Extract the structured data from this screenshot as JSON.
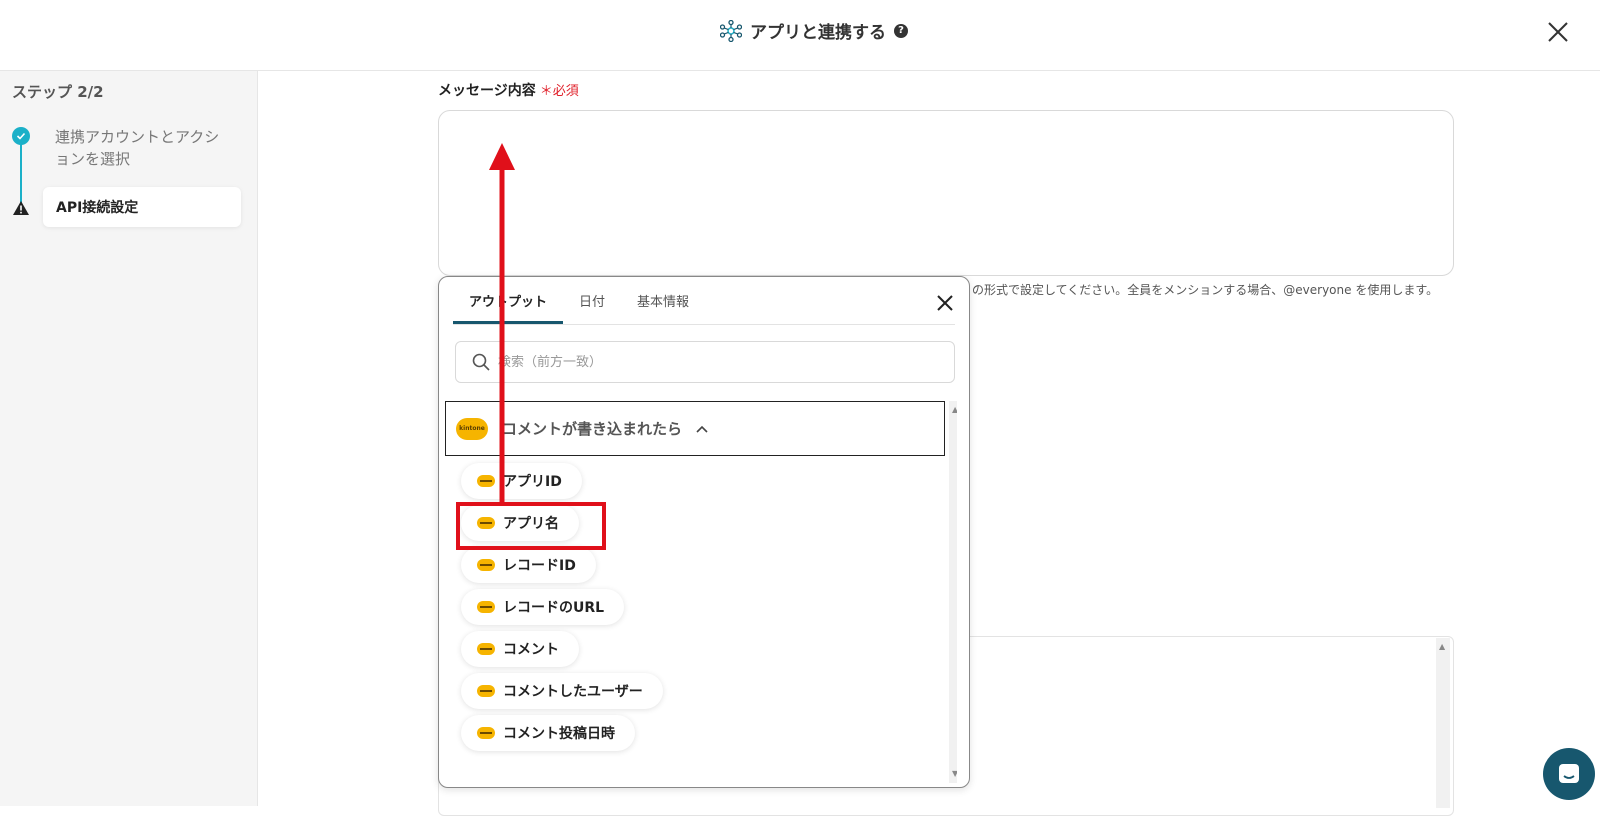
{
  "header": {
    "title": "アプリと連携する",
    "help_icon": "question-circle-icon",
    "close_icon": "close-icon"
  },
  "sidebar": {
    "step_label": "ステップ 2/2",
    "steps": [
      {
        "label": "連携アカウントとアクションを選択",
        "status": "done",
        "icon": "check-circle-icon"
      },
      {
        "label": "API接続設定",
        "status": "warning",
        "icon": "warning-triangle-icon"
      }
    ]
  },
  "main": {
    "field_label": "メッセージ内容",
    "required_label": "＊必須",
    "help_text": "の形式で設定してください。全員をメンションする場合、@everyone を使用します。"
  },
  "popup": {
    "tabs": [
      {
        "label": "アウトプット",
        "active": true
      },
      {
        "label": "日付",
        "active": false
      },
      {
        "label": "基本情報",
        "active": false
      }
    ],
    "search_placeholder": "検索（前方一致）",
    "group": {
      "logo_text": "kintone",
      "title": "コメントが書き込まれたら",
      "expanded": true
    },
    "items": [
      {
        "label": "アプリID"
      },
      {
        "label": "アプリ名",
        "highlighted": true
      },
      {
        "label": "レコードID"
      },
      {
        "label": "レコードのURL"
      },
      {
        "label": "コメント"
      },
      {
        "label": "コメントしたユーザー"
      },
      {
        "label": "コメント投稿日時"
      }
    ]
  },
  "colors": {
    "accent": "#1bb0c8",
    "tab_active": "#17576e",
    "annotation_red": "#e0101a",
    "kintone_yellow": "#f6b400"
  }
}
